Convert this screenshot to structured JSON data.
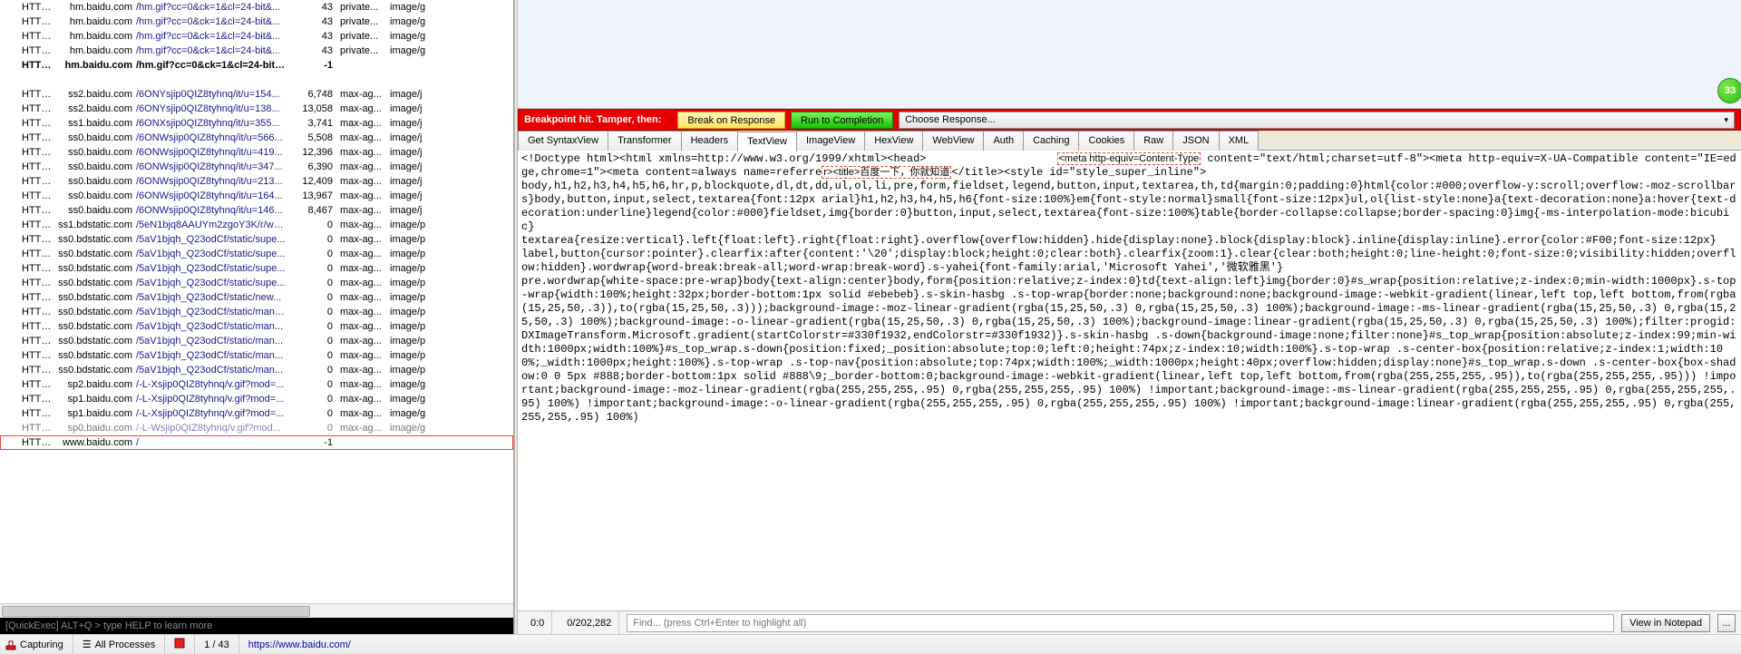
{
  "sessions": [
    {
      "proto": "HTTPS",
      "host": "hm.baidu.com",
      "url": "/hm.gif?cc=0&ck=1&cl=24-bit&...",
      "size": "43",
      "cache": "private...",
      "ctype": "image/g"
    },
    {
      "proto": "HTTPS",
      "host": "hm.baidu.com",
      "url": "/hm.gif?cc=0&ck=1&cl=24-bit&...",
      "size": "43",
      "cache": "private...",
      "ctype": "image/g"
    },
    {
      "proto": "HTTPS",
      "host": "hm.baidu.com",
      "url": "/hm.gif?cc=0&ck=1&cl=24-bit&...",
      "size": "43",
      "cache": "private...",
      "ctype": "image/g"
    },
    {
      "proto": "HTTPS",
      "host": "hm.baidu.com",
      "url": "/hm.gif?cc=0&ck=1&cl=24-bit&...",
      "size": "43",
      "cache": "private...",
      "ctype": "image/g"
    },
    {
      "proto": "HTTPS",
      "host": "hm.baidu.com",
      "url": "/hm.gif?cc=0&ck=1&cl=24-bit&...",
      "size": "-1",
      "cache": "",
      "ctype": "",
      "bold": true
    },
    {
      "proto": "",
      "host": "",
      "url": "",
      "size": "",
      "cache": "",
      "ctype": "",
      "blank": true
    },
    {
      "proto": "HTTPS",
      "host": "ss2.baidu.com",
      "url": "/6ONYsjip0QIZ8tyhnq/it/u=154...",
      "size": "6,748",
      "cache": "max-ag...",
      "ctype": "image/j"
    },
    {
      "proto": "HTTPS",
      "host": "ss2.baidu.com",
      "url": "/6ONYsjip0QIZ8tyhnq/it/u=138...",
      "size": "13,058",
      "cache": "max-ag...",
      "ctype": "image/j"
    },
    {
      "proto": "HTTPS",
      "host": "ss1.baidu.com",
      "url": "/6ONXsjip0QIZ8tyhnq/it/u=355...",
      "size": "3,741",
      "cache": "max-ag...",
      "ctype": "image/j"
    },
    {
      "proto": "HTTPS",
      "host": "ss0.baidu.com",
      "url": "/6ONWsjip0QIZ8tyhnq/it/u=566...",
      "size": "5,508",
      "cache": "max-ag...",
      "ctype": "image/j"
    },
    {
      "proto": "HTTPS",
      "host": "ss0.baidu.com",
      "url": "/6ONWsjip0QIZ8tyhnq/it/u=419...",
      "size": "12,396",
      "cache": "max-ag...",
      "ctype": "image/j"
    },
    {
      "proto": "HTTPS",
      "host": "ss0.baidu.com",
      "url": "/6ONWsjip0QIZ8tyhnq/it/u=347...",
      "size": "6,390",
      "cache": "max-ag...",
      "ctype": "image/j"
    },
    {
      "proto": "HTTPS",
      "host": "ss0.baidu.com",
      "url": "/6ONWsjip0QIZ8tyhnq/it/u=213...",
      "size": "12,409",
      "cache": "max-ag...",
      "ctype": "image/j"
    },
    {
      "proto": "HTTPS",
      "host": "ss0.baidu.com",
      "url": "/6ONWsjip0QIZ8tyhnq/it/u=164...",
      "size": "13,967",
      "cache": "max-ag...",
      "ctype": "image/j"
    },
    {
      "proto": "HTTPS",
      "host": "ss0.baidu.com",
      "url": "/6ONWsjip0QIZ8tyhnq/it/u=146...",
      "size": "8,467",
      "cache": "max-ag...",
      "ctype": "image/j"
    },
    {
      "proto": "HTTPS",
      "host": "ss1.bdstatic.com",
      "url": "/5eN1bjq8AAUYm2zgoY3K/r/ww...",
      "size": "0",
      "cache": "max-ag...",
      "ctype": "image/p"
    },
    {
      "proto": "HTTPS",
      "host": "ss0.bdstatic.com",
      "url": "/5aV1bjqh_Q23odCf/static/supe...",
      "size": "0",
      "cache": "max-ag...",
      "ctype": "image/p"
    },
    {
      "proto": "HTTPS",
      "host": "ss0.bdstatic.com",
      "url": "/5aV1bjqh_Q23odCf/static/supe...",
      "size": "0",
      "cache": "max-ag...",
      "ctype": "image/p"
    },
    {
      "proto": "HTTPS",
      "host": "ss0.bdstatic.com",
      "url": "/5aV1bjqh_Q23odCf/static/supe...",
      "size": "0",
      "cache": "max-ag...",
      "ctype": "image/p"
    },
    {
      "proto": "HTTPS",
      "host": "ss0.bdstatic.com",
      "url": "/5aV1bjqh_Q23odCf/static/supe...",
      "size": "0",
      "cache": "max-ag...",
      "ctype": "image/p"
    },
    {
      "proto": "HTTPS",
      "host": "ss0.bdstatic.com",
      "url": "/5aV1bjqh_Q23odCf/static/new...",
      "size": "0",
      "cache": "max-ag...",
      "ctype": "image/p"
    },
    {
      "proto": "HTTPS",
      "host": "ss0.bdstatic.com",
      "url": "/5aV1bjqh_Q23odCf/static/mant...",
      "size": "0",
      "cache": "max-ag...",
      "ctype": "image/p"
    },
    {
      "proto": "HTTPS",
      "host": "ss0.bdstatic.com",
      "url": "/5aV1bjqh_Q23odCf/static/man...",
      "size": "0",
      "cache": "max-ag...",
      "ctype": "image/p"
    },
    {
      "proto": "HTTPS",
      "host": "ss0.bdstatic.com",
      "url": "/5aV1bjqh_Q23odCf/static/man...",
      "size": "0",
      "cache": "max-ag...",
      "ctype": "image/p"
    },
    {
      "proto": "HTTPS",
      "host": "ss0.bdstatic.com",
      "url": "/5aV1bjqh_Q23odCf/static/man...",
      "size": "0",
      "cache": "max-ag...",
      "ctype": "image/p"
    },
    {
      "proto": "HTTPS",
      "host": "ss0.bdstatic.com",
      "url": "/5aV1bjqh_Q23odCf/static/man...",
      "size": "0",
      "cache": "max-ag...",
      "ctype": "image/p"
    },
    {
      "proto": "HTTPS",
      "host": "sp2.baidu.com",
      "url": "/-L-Xsjip0QIZ8tyhnq/v.gif?mod=...",
      "size": "0",
      "cache": "max-ag...",
      "ctype": "image/g"
    },
    {
      "proto": "HTTPS",
      "host": "sp1.baidu.com",
      "url": "/-L-Xsjip0QIZ8tyhnq/v.gif?mod=...",
      "size": "0",
      "cache": "max-ag...",
      "ctype": "image/g"
    },
    {
      "proto": "HTTPS",
      "host": "sp1.baidu.com",
      "url": "/-L-Xsjip0QIZ8tyhnq/v.gif?mod=...",
      "size": "0",
      "cache": "max-ag...",
      "ctype": "image/g"
    },
    {
      "proto": "HTTPS",
      "host": "sp0.baidu.com",
      "url": "/-L-Wsjip0QIZ8tyhnq/v.gif?mod...",
      "size": "0",
      "cache": "max-ag...",
      "ctype": "image/g",
      "faded": true
    },
    {
      "proto": "HTTPS",
      "host": "www.baidu.com",
      "url": "/",
      "size": "-1",
      "cache": "",
      "ctype": "",
      "selected": true
    }
  ],
  "quickexec": "[QuickExec] ALT+Q > type HELP to learn more",
  "statusbar": {
    "capturing": "Capturing",
    "processes": "All Processes",
    "count": "1 / 43",
    "url": "https://www.baidu.com/"
  },
  "badge": "33",
  "breakpoint": {
    "label": "Breakpoint hit. Tamper, then:",
    "break_resp": "Break on Response",
    "run": "Run to Completion",
    "choose": "Choose Response..."
  },
  "tabs": [
    "Get SyntaxView",
    "Transformer",
    "Headers",
    "TextView",
    "ImageView",
    "HexView",
    "WebView",
    "Auth",
    "Caching",
    "Cookies",
    "Raw",
    "JSON",
    "XML"
  ],
  "active_tab": 3,
  "textview_pre": "<!Doctype html><html xmlns=http://www.w3.org/1999/xhtml><head>",
  "textview_hl1": "<meta http-equiv=Content-Type",
  "textview_mid1": " content=\"text/html;charset=utf-8\"><meta http-equiv=X-UA-Compatible content=\"IE=edge,chrome=1\"><meta content=always name=referre",
  "textview_hl2": "r><title>百度一下，你就知道",
  "textview_rest": "</title><style id=\"style_super_inline\">\nbody,h1,h2,h3,h4,h5,h6,hr,p,blockquote,dl,dt,dd,ul,ol,li,pre,form,fieldset,legend,button,input,textarea,th,td{margin:0;padding:0}html{color:#000;overflow-y:scroll;overflow:-moz-scrollbars}body,button,input,select,textarea{font:12px arial}h1,h2,h3,h4,h5,h6{font-size:100%}em{font-style:normal}small{font-size:12px}ul,ol{list-style:none}a{text-decoration:none}a:hover{text-decoration:underline}legend{color:#000}fieldset,img{border:0}button,input,select,textarea{font-size:100%}table{border-collapse:collapse;border-spacing:0}img{-ms-interpolation-mode:bicubic}\ntextarea{resize:vertical}.left{float:left}.right{float:right}.overflow{overflow:hidden}.hide{display:none}.block{display:block}.inline{display:inline}.error{color:#F00;font-size:12px}\nlabel,button{cursor:pointer}.clearfix:after{content:'\\20';display:block;height:0;clear:both}.clearfix{zoom:1}.clear{clear:both;height:0;line-height:0;font-size:0;visibility:hidden;overflow:hidden}.wordwrap{word-break:break-all;word-wrap:break-word}.s-yahei{font-family:arial,'Microsoft Yahei','微软雅黑'}\npre.wordwrap{white-space:pre-wrap}body{text-align:center}body,form{position:relative;z-index:0}td{text-align:left}img{border:0}#s_wrap{position:relative;z-index:0;min-width:1000px}.s-top-wrap{width:100%;height:32px;border-bottom:1px solid #ebebeb}.s-skin-hasbg .s-top-wrap{border:none;background:none;background-image:-webkit-gradient(linear,left top,left bottom,from(rgba(15,25,50,.3)),to(rgba(15,25,50,.3)));background-image:-moz-linear-gradient(rgba(15,25,50,.3) 0,rgba(15,25,50,.3) 100%);background-image:-ms-linear-gradient(rgba(15,25,50,.3) 0,rgba(15,25,50,.3) 100%);background-image:-o-linear-gradient(rgba(15,25,50,.3) 0,rgba(15,25,50,.3) 100%);background-image:linear-gradient(rgba(15,25,50,.3) 0,rgba(15,25,50,.3) 100%);filter:progid:DXImageTransform.Microsoft.gradient(startColorstr=#330f1932,endColorstr=#330f1932)}.s-skin-hasbg .s-down{background-image:none;filter:none}#s_top_wrap{position:absolute;z-index:99;min-width:1000px;width:100%}#s_top_wrap.s-down{position:fixed;_position:absolute;top:0;left:0;height:74px;z-index:10;width:100%}.s-top-wrap .s-center-box{position:relative;z-index:1;width:100%;_width:1000px;height:100%}.s-top-wrap .s-top-nav{position:absolute;top:74px;width:100%;_width:1000px;height:40px;overflow:hidden;display:none}#s_top_wrap.s-down .s-center-box{box-shadow:0 0 5px #888;border-bottom:1px solid #888\\9;_border-bottom:0;background-image:-webkit-gradient(linear,left top,left bottom,from(rgba(255,255,255,.95)),to(rgba(255,255,255,.95))) !important;background-image:-moz-linear-gradient(rgba(255,255,255,.95) 0,rgba(255,255,255,.95) 100%) !important;background-image:-ms-linear-gradient(rgba(255,255,255,.95) 0,rgba(255,255,255,.95) 100%) !important;background-image:-o-linear-gradient(rgba(255,255,255,.95) 0,rgba(255,255,255,.95) 100%) !important;background-image:linear-gradient(rgba(255,255,255,.95) 0,rgba(255,255,255,.95) 100%)",
  "footer": {
    "pos": "0:0",
    "total": "0/202,282",
    "find_placeholder": "Find... (press Ctrl+Enter to highlight all)",
    "notepad": "View in Notepad",
    "ellipsis": "..."
  }
}
